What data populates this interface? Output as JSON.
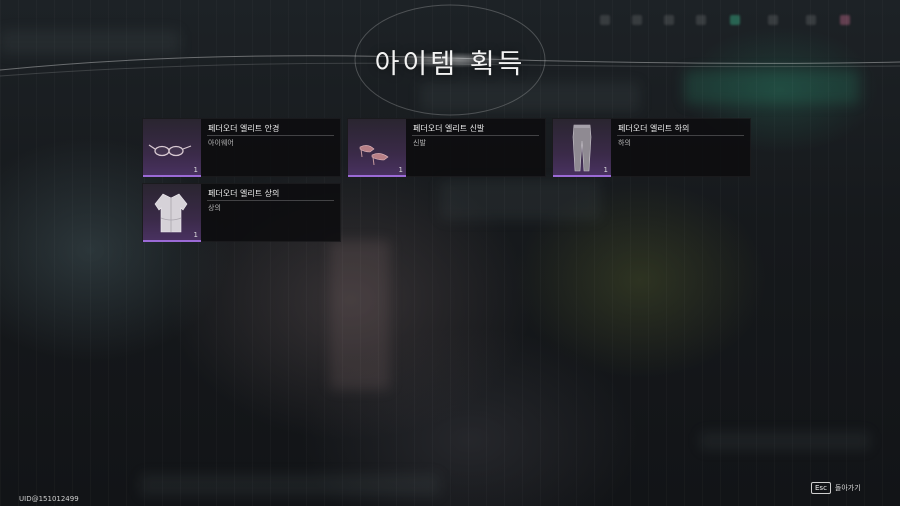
{
  "title": "아이템 획득",
  "items": [
    {
      "name": "페더오더 엘리트 안경",
      "type": "아이웨어",
      "quantity": "1",
      "icon": "glasses-icon"
    },
    {
      "name": "페더오더 엘리트 신발",
      "type": "신발",
      "quantity": "1",
      "icon": "shoes-icon"
    },
    {
      "name": "페더오더 엘리트 하의",
      "type": "하의",
      "quantity": "1",
      "icon": "pants-icon"
    },
    {
      "name": "페더오더 엘리트 상의",
      "type": "상의",
      "quantity": "1",
      "icon": "top-icon"
    }
  ],
  "footer": {
    "uid": "UID@151012499",
    "esc_key": "Esc",
    "back_label": "돌아가기"
  },
  "colors": {
    "rarity_accent": "#9b6ad6",
    "thumb_bg": "#3a2a48"
  }
}
